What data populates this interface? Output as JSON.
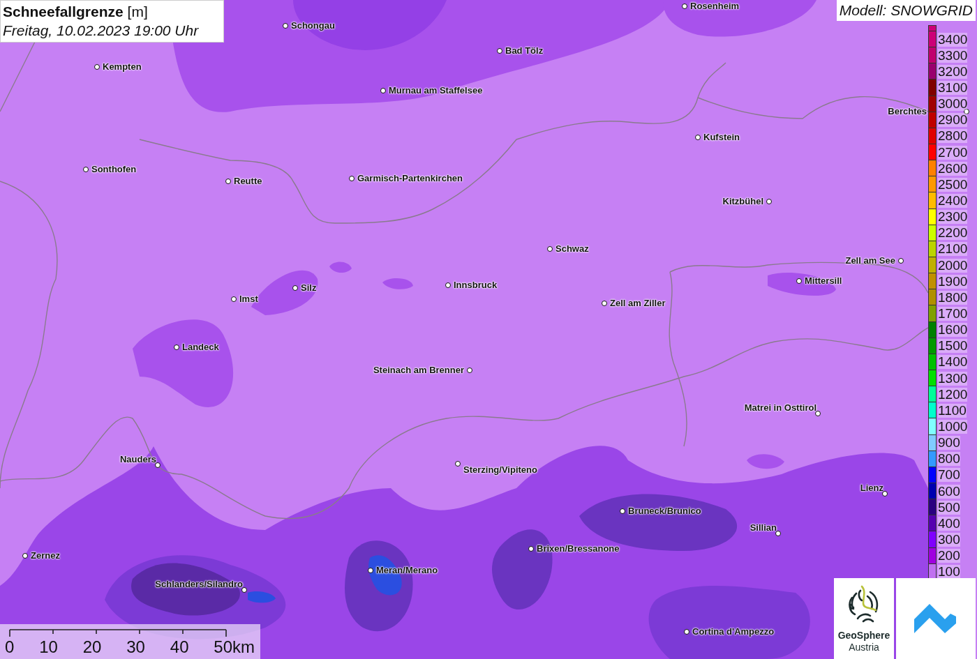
{
  "title": {
    "heading": "**Schneefallgrenze** [m]",
    "datetime": "Freitag, 10.02.2023 19:00 Uhr"
  },
  "model_label": "Modell: SNOWGRID",
  "cities": [
    {
      "name": "Schongau"
    },
    {
      "name": "Rosenheim"
    },
    {
      "name": "Bad Tölz"
    },
    {
      "name": "Kempten"
    },
    {
      "name": "Murnau am Staffelsee"
    },
    {
      "name": "Berchtes"
    },
    {
      "name": "Kufstein"
    },
    {
      "name": "Sonthofen"
    },
    {
      "name": "Reutte"
    },
    {
      "name": "Garmisch-Partenkirchen"
    },
    {
      "name": "Kitzbühel"
    },
    {
      "name": "Schwaz"
    },
    {
      "name": "Zell am See"
    },
    {
      "name": "Mittersill"
    },
    {
      "name": "Silz"
    },
    {
      "name": "Innsbruck"
    },
    {
      "name": "Imst"
    },
    {
      "name": "Zell am Ziller"
    },
    {
      "name": "Landeck"
    },
    {
      "name": "Steinach am Brenner"
    },
    {
      "name": "Matrei in Osttirol"
    },
    {
      "name": "Nauders"
    },
    {
      "name": "Sterzing/Vipiteno"
    },
    {
      "name": "Lienz"
    },
    {
      "name": "Bruneck/Brunico"
    },
    {
      "name": "Sillian"
    },
    {
      "name": "Brixen/Bressanone"
    },
    {
      "name": "Zernez"
    },
    {
      "name": "Meran/Merano"
    },
    {
      "name": "Schlanders/Silandro"
    },
    {
      "name": "Cortina d'Ampezzo"
    }
  ],
  "legend": [
    {
      "label": "3400",
      "color": "#cc0077"
    },
    {
      "label": "3300",
      "color": "#c0006e"
    },
    {
      "label": "3200",
      "color": "#99006e"
    },
    {
      "label": "3100",
      "color": "#800000"
    },
    {
      "label": "3000",
      "color": "#a00000"
    },
    {
      "label": "2900",
      "color": "#c00000"
    },
    {
      "label": "2800",
      "color": "#e00000"
    },
    {
      "label": "2700",
      "color": "#ff0000"
    },
    {
      "label": "2600",
      "color": "#ff8000"
    },
    {
      "label": "2500",
      "color": "#ff9900"
    },
    {
      "label": "2400",
      "color": "#ffbb00"
    },
    {
      "label": "2300",
      "color": "#ffff00"
    },
    {
      "label": "2200",
      "color": "#ccff00"
    },
    {
      "label": "2100",
      "color": "#bbd400"
    },
    {
      "label": "2000",
      "color": "#c0b000"
    },
    {
      "label": "1900",
      "color": "#c09000"
    },
    {
      "label": "1800",
      "color": "#b09000"
    },
    {
      "label": "1700",
      "color": "#80a000"
    },
    {
      "label": "1600",
      "color": "#008000"
    },
    {
      "label": "1500",
      "color": "#009900"
    },
    {
      "label": "1400",
      "color": "#00c000"
    },
    {
      "label": "1300",
      "color": "#00e000"
    },
    {
      "label": "1200",
      "color": "#00ff99"
    },
    {
      "label": "1100",
      "color": "#00ffcc"
    },
    {
      "label": "1000",
      "color": "#80ffff"
    },
    {
      "label": "900",
      "color": "#80ccff"
    },
    {
      "label": "800",
      "color": "#3399ff"
    },
    {
      "label": "700",
      "color": "#0000ff"
    },
    {
      "label": "600",
      "color": "#0000b0"
    },
    {
      "label": "500",
      "color": "#2a0080"
    },
    {
      "label": "400",
      "color": "#5500b0"
    },
    {
      "label": "300",
      "color": "#8000ff"
    },
    {
      "label": "200",
      "color": "#a000e0"
    },
    {
      "label": "100",
      "color": "#c070f0"
    }
  ],
  "scale_bar": {
    "ticks": [
      "0",
      "10",
      "20",
      "30",
      "40",
      "50km"
    ]
  },
  "logos": {
    "geosphere": {
      "line1": "GeoSphere",
      "line2": "Austria"
    }
  }
}
